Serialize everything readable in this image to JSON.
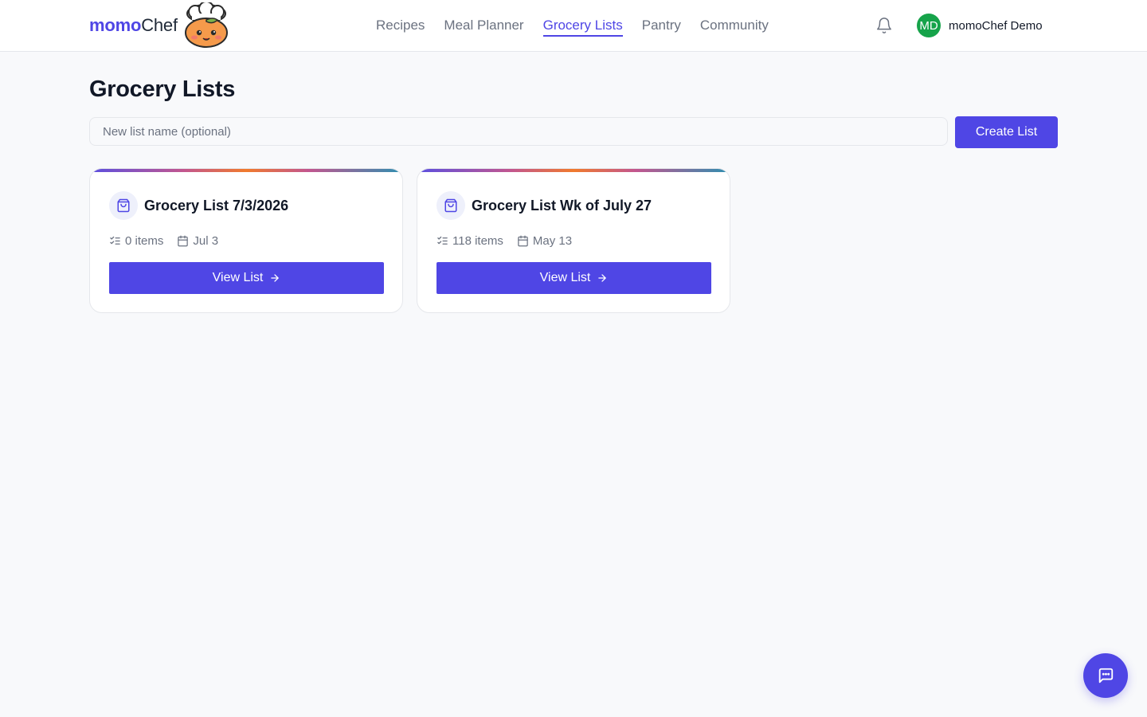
{
  "brand": {
    "part1": "momo",
    "part2": "Chef",
    "mascot_icon": "peach-chef-mascot-icon"
  },
  "nav": [
    {
      "label": "Recipes",
      "active": false
    },
    {
      "label": "Meal Planner",
      "active": false
    },
    {
      "label": "Grocery Lists",
      "active": true
    },
    {
      "label": "Pantry",
      "active": false
    },
    {
      "label": "Community",
      "active": false
    }
  ],
  "header": {
    "bell_icon": "bell-icon",
    "user_initials": "MD",
    "user_name": "momoChef Demo"
  },
  "page": {
    "title": "Grocery Lists",
    "new_list_placeholder": "New list name (optional)",
    "new_list_value": "",
    "create_label": "Create List"
  },
  "lists": [
    {
      "title": "Grocery List 7/3/2026",
      "items": "0 items",
      "date": "Jul 3",
      "button": "View List"
    },
    {
      "title": "Grocery List Wk of July 27",
      "items": "118 items",
      "date": "May 13",
      "button": "View List"
    }
  ],
  "icons": {
    "card": "shopping-bag-icon",
    "items": "checklist-icon",
    "date": "calendar-icon",
    "arrow": "arrow-right-icon",
    "chat": "chat-icon"
  },
  "colors": {
    "accent": "#4f46e5",
    "avatar": "#16a34a",
    "background": "#f8f9fb"
  }
}
